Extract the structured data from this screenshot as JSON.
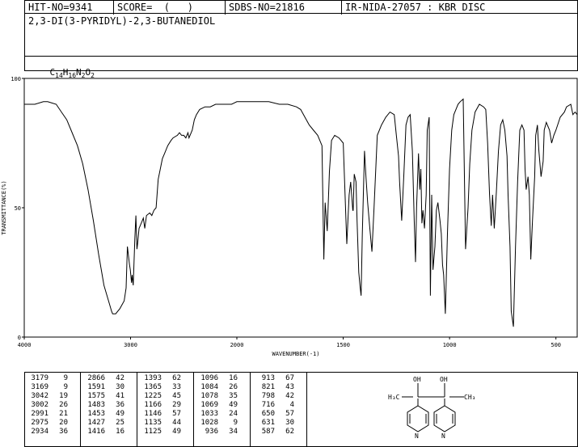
{
  "header": {
    "hit_no": "HIT-NO=9341",
    "score": "SCORE=  (   )",
    "sdbs_no": "SDBS-NO=21816",
    "ir_id": "IR-NIDA-27057 : KBR DISC"
  },
  "compound": {
    "name": "2,3-DI(3-PYRIDYL)-2,3-BUTANEDIOL",
    "formula_parts": [
      "C",
      "14",
      "H",
      "16",
      "N",
      "2",
      "O",
      "2"
    ]
  },
  "chart_data": {
    "type": "line",
    "xlabel": "WAVENUMBER(-1)",
    "ylabel": "TRANSMITTANCE(%)",
    "xlim": [
      4000,
      400
    ],
    "ylim": [
      0,
      100
    ],
    "x_ticks": [
      "4000",
      "3000",
      "2000",
      "1500",
      "1000",
      "500"
    ],
    "y_ticks": [
      "100",
      "50",
      "0"
    ],
    "grid": false,
    "series": [
      {
        "x": [
          4000,
          3900,
          3820,
          3780,
          3700,
          3650,
          3600,
          3560,
          3500,
          3450,
          3400,
          3350,
          3300,
          3250,
          3200,
          3179,
          3169,
          3140,
          3100,
          3060,
          3042,
          3030,
          3010,
          3002,
          2991,
          2985,
          2975,
          2960,
          2950,
          2940,
          2934,
          2920,
          2900,
          2880,
          2866,
          2850,
          2820,
          2800,
          2780,
          2760,
          2740,
          2720,
          2700,
          2680,
          2650,
          2620,
          2600,
          2560,
          2540,
          2520,
          2500,
          2480,
          2460,
          2450,
          2420,
          2400,
          2380,
          2350,
          2300,
          2250,
          2200,
          2150,
          2100,
          2050,
          2000,
          1950,
          1900,
          1850,
          1800,
          1760,
          1720,
          1700,
          1680,
          1660,
          1640,
          1620,
          1600,
          1591,
          1585,
          1575,
          1565,
          1555,
          1540,
          1520,
          1500,
          1483,
          1472,
          1465,
          1455,
          1453,
          1448,
          1440,
          1435,
          1427,
          1420,
          1416,
          1410,
          1400,
          1393,
          1385,
          1375,
          1365,
          1355,
          1340,
          1320,
          1300,
          1280,
          1260,
          1250,
          1240,
          1235,
          1225,
          1215,
          1205,
          1195,
          1185,
          1175,
          1166,
          1160,
          1155,
          1146,
          1140,
          1135,
          1130,
          1125,
          1118,
          1110,
          1105,
          1096,
          1090,
          1084,
          1078,
          1069,
          1062,
          1055,
          1045,
          1039,
          1033,
          1028,
          1020,
          1010,
          1000,
          990,
          980,
          970,
          960,
          950,
          936,
          925,
          913,
          905,
          895,
          880,
          860,
          840,
          830,
          821,
          812,
          804,
          798,
          790,
          780,
          770,
          760,
          750,
          740,
          730,
          725,
          716,
          710,
          700,
          690,
          680,
          670,
          660,
          650,
          645,
          640,
          631,
          625,
          618,
          610,
          600,
          595,
          587,
          580,
          570,
          560,
          555,
          545,
          530,
          520,
          510,
          500,
          480,
          460,
          450,
          430,
          420,
          410,
          400
        ],
        "y": [
          90,
          90,
          91,
          91,
          90,
          87,
          84,
          80,
          74,
          67,
          57,
          45,
          32,
          20,
          13,
          10,
          9,
          9,
          11,
          14,
          19,
          35,
          28,
          26,
          21,
          24,
          20,
          38,
          47,
          34,
          36,
          42,
          44,
          46,
          42,
          47,
          48,
          47,
          49,
          50,
          61,
          65,
          69,
          71,
          74,
          76,
          77,
          78,
          79,
          78,
          78,
          77,
          79,
          77,
          80,
          84,
          86,
          88,
          89,
          89,
          90,
          90,
          90,
          90,
          91,
          91,
          91,
          91,
          90,
          90,
          89,
          88,
          85,
          82,
          80,
          78,
          74,
          30,
          52,
          41,
          64,
          76,
          78,
          77,
          75,
          36,
          55,
          60,
          49,
          49,
          63,
          60,
          45,
          25,
          19,
          16,
          40,
          72,
          62,
          52,
          42,
          33,
          50,
          78,
          82,
          85,
          87,
          86,
          78,
          70,
          60,
          45,
          63,
          82,
          85,
          86,
          72,
          45,
          29,
          50,
          71,
          57,
          65,
          44,
          49,
          42,
          55,
          80,
          85,
          16,
          55,
          26,
          35,
          49,
          52,
          45,
          40,
          28,
          24,
          9,
          40,
          65,
          80,
          86,
          88,
          90,
          91,
          92,
          34,
          50,
          67,
          80,
          87,
          90,
          89,
          88,
          75,
          55,
          43,
          55,
          42,
          56,
          72,
          82,
          84,
          80,
          70,
          55,
          35,
          10,
          4,
          35,
          60,
          80,
          82,
          80,
          65,
          57,
          62,
          55,
          30,
          45,
          62,
          78,
          82,
          72,
          62,
          68,
          80,
          83,
          80,
          75,
          78,
          80,
          85,
          87,
          89,
          90,
          86,
          87,
          86
        ]
      }
    ]
  },
  "peak_table": [
    [
      [
        "3179",
        "9"
      ],
      [
        "3169",
        "9"
      ],
      [
        "3042",
        "19"
      ],
      [
        "3002",
        "26"
      ],
      [
        "2991",
        "21"
      ],
      [
        "2975",
        "20"
      ],
      [
        "2934",
        "36"
      ]
    ],
    [
      [
        "2866",
        "42"
      ],
      [
        "1591",
        "30"
      ],
      [
        "1575",
        "41"
      ],
      [
        "1483",
        "36"
      ],
      [
        "1453",
        "49"
      ],
      [
        "1427",
        "25"
      ],
      [
        "1416",
        "16"
      ]
    ],
    [
      [
        "1393",
        "62"
      ],
      [
        "1365",
        "33"
      ],
      [
        "1225",
        "45"
      ],
      [
        "1166",
        "29"
      ],
      [
        "1146",
        "57"
      ],
      [
        "1135",
        "44"
      ],
      [
        "1125",
        "49"
      ]
    ],
    [
      [
        "1096",
        "16"
      ],
      [
        "1084",
        "26"
      ],
      [
        "1078",
        "35"
      ],
      [
        "1069",
        "49"
      ],
      [
        "1033",
        "24"
      ],
      [
        "1028",
        "9"
      ],
      [
        "936",
        "34"
      ]
    ],
    [
      [
        "913",
        "67"
      ],
      [
        "821",
        "43"
      ],
      [
        "798",
        "42"
      ],
      [
        "716",
        "4"
      ],
      [
        "650",
        "57"
      ],
      [
        "631",
        "30"
      ],
      [
        "587",
        "62"
      ]
    ]
  ],
  "structure_labels": {
    "oh_left": "OH",
    "oh_right": "OH",
    "c_left": "C",
    "c_right": "C",
    "ch3_left": "H₃C",
    "ch3_right": "CH₃",
    "n_left": "N",
    "n_right": "N"
  }
}
